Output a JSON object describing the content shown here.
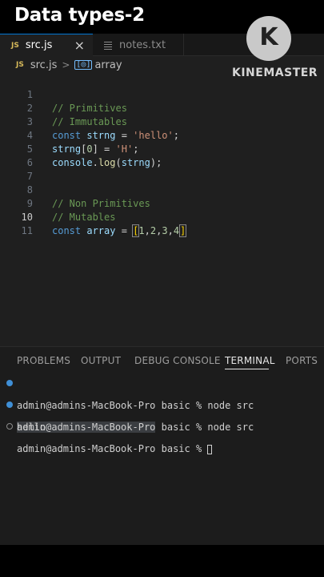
{
  "banner": {
    "title": "Data types-2"
  },
  "logo": {
    "letter": "K",
    "text": "KINEMASTER"
  },
  "tabs": [
    {
      "badge": "JS",
      "label": "src.js",
      "close": "×"
    },
    {
      "label": "notes.txt"
    }
  ],
  "breadcrumb": {
    "badge": "JS",
    "file": "src.js",
    "separator": ">",
    "symbol_icon": "[◎]",
    "symbol": "array"
  },
  "editor": {
    "line_numbers": [
      "1",
      "2",
      "3",
      "4",
      "5",
      "6",
      "7",
      "8",
      "9",
      "10",
      "11"
    ],
    "active_line": "10",
    "lines": [
      {
        "comment": "// Primitives"
      },
      {
        "comment": "// Immutables"
      },
      {
        "kw": "const",
        "var": "strng",
        "op": " = ",
        "str": "'hello'",
        "end": ";"
      },
      {
        "var": "strng",
        "open": "[",
        "num": "0",
        "close": "]",
        "op": " = ",
        "str": "'H'",
        "end": ";"
      },
      {
        "obj": "console",
        "dot": ".",
        "fn": "log",
        "open": "(",
        "var": "strng",
        "close": ");"
      },
      {},
      {},
      {
        "comment": "// Non Primitives"
      },
      {
        "comment": "// Mutables"
      },
      {
        "kw": "const",
        "var": "array",
        "op": " = ",
        "open": "[",
        "n1": "1",
        "n2": "2",
        "n3": "3",
        "n4": "4",
        "comma": ",",
        "close": "]"
      },
      {}
    ]
  },
  "panel": {
    "tabs": [
      "PROBLEMS",
      "OUTPUT",
      "DEBUG CONSOLE",
      "TERMINAL",
      "PORTS"
    ],
    "active_tab": "TERMINAL",
    "terminal": [
      {
        "prompt": "admin@admins-MacBook-Pro",
        "rest": " basic % node src"
      },
      {
        "prompt": "admin@admins-MacBook-Pro",
        "rest": " basic % node src"
      },
      {
        "output": "hello"
      },
      {
        "prompt": "admin@admins-MacBook-Pro",
        "rest": " basic % "
      }
    ]
  },
  "colors": {
    "accent": "#0078d4",
    "comment": "#6a9955",
    "keyword": "#569cd6",
    "string": "#ce9178",
    "number": "#b5cea8",
    "function": "#dcdcaa"
  }
}
